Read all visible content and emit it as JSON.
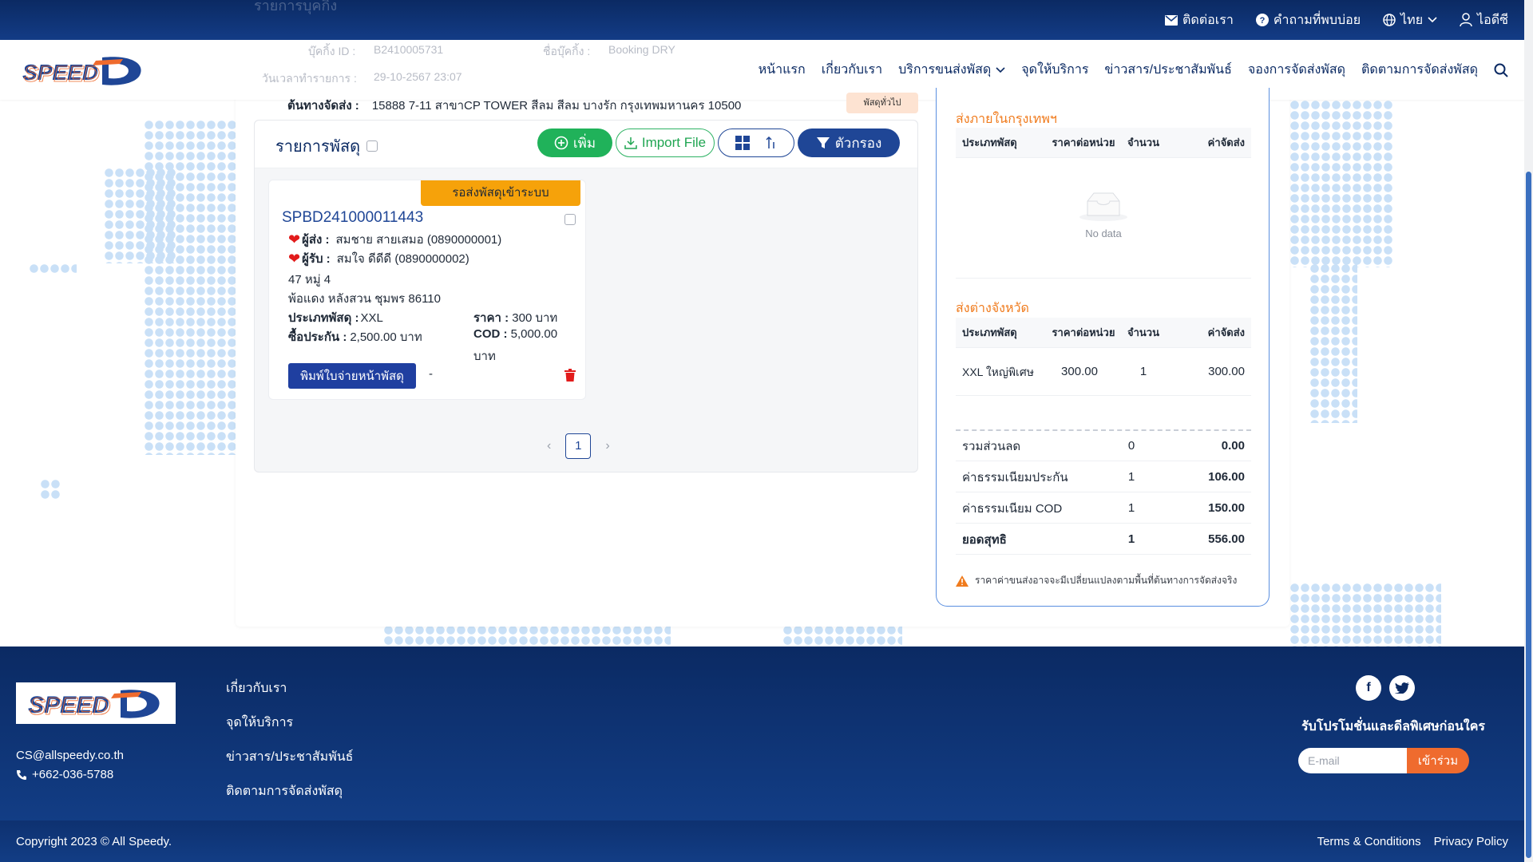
{
  "topbar": {
    "contact": "ติดต่อเรา",
    "faq": "คำถามที่พบบ่อย",
    "language": "ไทย",
    "user": "ไอดีซี",
    "ghost_text": "รายการบุคกิ้ง"
  },
  "brand": {
    "logo_text": "SPEED D"
  },
  "nav": {
    "items": [
      "หน้าแรก",
      "เกี่ยวกับเรา",
      "บริการขนส่งพัสดุ",
      "จุดให้บริการ",
      "ข่าวสาร/ประชาสัมพันธ์",
      "จองการจัดส่งพัสดุ",
      "ติดตามการจัดส่งพัสดุ"
    ],
    "ghost_booking_id_label": "บุ๊คกิ้ง ID :",
    "ghost_booking_id": "B2410005731",
    "ghost_booking_name_label": "ชื่อบุ๊คกิ้ง :",
    "ghost_booking_name": "Booking DRY",
    "ghost_date_label": "วันเวลาทำรายการ :",
    "ghost_date": "29-10-2567 23:07"
  },
  "destination": {
    "label": "ต้นทางจัดส่ง :",
    "address": "15888 7-11 สาขาCP TOWER สีลม สีลม บางรัก กรุงเทพมหานคร 10500",
    "tag": "พัสดุทั่วไป"
  },
  "parcel_panel": {
    "title": "รายการพัสดุ",
    "add_label": "เพิ่ม",
    "import_label": "Import File",
    "filter_label": "ตัวกรอง"
  },
  "parcel": {
    "status": "รอส่งพัสดุเข้าระบบ",
    "id": "SPBD241000011443",
    "sender_label": "ผู้ส่ง :",
    "sender": "สมชาย สายเสมอ  (0890000001)",
    "receiver_label": "ผู้รับ :",
    "receiver": "สมใจ ดีดีดี  (0890000002)",
    "address1": "47 หมู่ 4",
    "address2": "พ้อแดง หลังสวน ชุมพร 86110",
    "type_label": "ประเภทพัสดุ :",
    "type": "XXL",
    "price_label": "ราคา :",
    "price": "300 บาท",
    "insure_label": "ซื้อประกัน :",
    "insure": "2,500.00 บาท",
    "cod_label": "COD :",
    "cod": "5,000.00",
    "cod_unit": "บาท",
    "print_label": "พิมพ์ใบจ่ายหน้าพัสดุ",
    "dash": "-"
  },
  "pagination": {
    "current": "1"
  },
  "summary": {
    "bkk_title": "ส่งภายในกรุงเทพฯ",
    "headers": [
      "ประเภทพัสดุ",
      "ราคาต่อหน่วย",
      "จำนวน",
      "ค่าจัดส่ง"
    ],
    "no_data": "No data",
    "province_title": "ส่งต่างจังหวัด",
    "province_rows": [
      {
        "type": "XXL ใหญ่พิเศษ",
        "unit_price": "300.00",
        "qty": "1",
        "fee": "300.00"
      }
    ],
    "totals": [
      {
        "label": "รวมส่วนลด",
        "qty": "0",
        "value": "0.00"
      },
      {
        "label": "ค่าธรรมเนียมประกัน",
        "qty": "1",
        "value": "106.00"
      },
      {
        "label": "ค่าธรรมเนียม COD",
        "qty": "1",
        "value": "150.00"
      },
      {
        "label": "ยอดสุทธิ",
        "qty": "1",
        "value": "556.00"
      }
    ],
    "note": "ราคาค่าขนส่งอาจจะมีเปลี่ยนแปลงตามพื้นที่ต้นทางการจัดส่งจริง"
  },
  "footer": {
    "email": "CS@allspeedy.co.th",
    "phone": "+662-036-5788",
    "links": [
      "เกี่ยวกับเรา",
      "จุดให้บริการ",
      "ข่าวสาร/ประชาสัมพันธ์",
      "ติดตามการจัดส่งพัสดุ"
    ],
    "promo": "รับโปรโมชั่นและดีลพิเศษก่อนใคร",
    "email_placeholder": "E-mail",
    "join_label": "เข้าร่วม",
    "copyright": "Copyright 2023 © All Speedy.",
    "terms": "Terms & Conditions",
    "privacy": "Privacy Policy"
  },
  "colors": {
    "brand_navy": "#0b2a63",
    "accent_orange": "#f07b1d",
    "status_amber": "#f6a20a",
    "primary_blue": "#1f4696",
    "add_green": "#20b25a"
  }
}
